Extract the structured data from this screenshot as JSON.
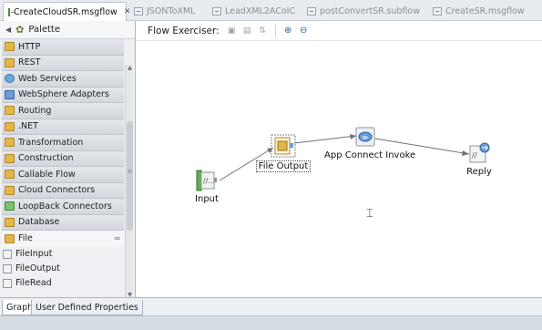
{
  "editor_tabs": [
    {
      "label": "CreateCloudSR.msgflow",
      "active": true,
      "closable": true
    },
    {
      "label": "JSONToXML",
      "active": false
    },
    {
      "label": "LeadXML2ACoIC",
      "active": false
    },
    {
      "label": "postConvertSR.subflow",
      "active": false
    },
    {
      "label": "CreateSR.msgflow",
      "active": false
    }
  ],
  "palette": {
    "title": "Palette",
    "drawers": [
      {
        "label": "HTTP",
        "icon": "folder-icon"
      },
      {
        "label": "REST",
        "icon": "folder-icon"
      },
      {
        "label": "Web Services",
        "icon": "globe-icon"
      },
      {
        "label": "WebSphere Adapters",
        "icon": "adapter-icon"
      },
      {
        "label": "Routing",
        "icon": "folder-icon"
      },
      {
        "label": ".NET",
        "icon": "folder-icon"
      },
      {
        "label": "Transformation",
        "icon": "folder-icon"
      },
      {
        "label": "Construction",
        "icon": "folder-icon"
      },
      {
        "label": "Callable Flow",
        "icon": "folder-icon"
      },
      {
        "label": "Cloud Connectors",
        "icon": "folder-icon"
      },
      {
        "label": "LoopBack Connectors",
        "icon": "loopback-icon"
      },
      {
        "label": "Database",
        "icon": "folder-icon"
      },
      {
        "label": "File",
        "icon": "file-icon",
        "open": true
      }
    ],
    "file_nodes": [
      "FileInput",
      "FileOutput",
      "FileRead"
    ]
  },
  "canvas": {
    "toolbar_label": "Flow Exerciser:",
    "nodes": [
      {
        "label": "Input",
        "icon": "mq-input-icon"
      },
      {
        "label": "File Output",
        "icon": "file-output-icon",
        "selected": true
      },
      {
        "label": "App Connect Invoke",
        "icon": "app-connect-invoke-icon"
      },
      {
        "label": "Reply",
        "icon": "reply-icon"
      }
    ]
  },
  "bottom_tabs": [
    {
      "label": "Graph",
      "active": true
    },
    {
      "label": "User Defined Properties",
      "active": false
    }
  ],
  "colors": {
    "accent_blue": "#2e64a8",
    "folder": "#e3b648",
    "node_green": "#3f8a32"
  }
}
